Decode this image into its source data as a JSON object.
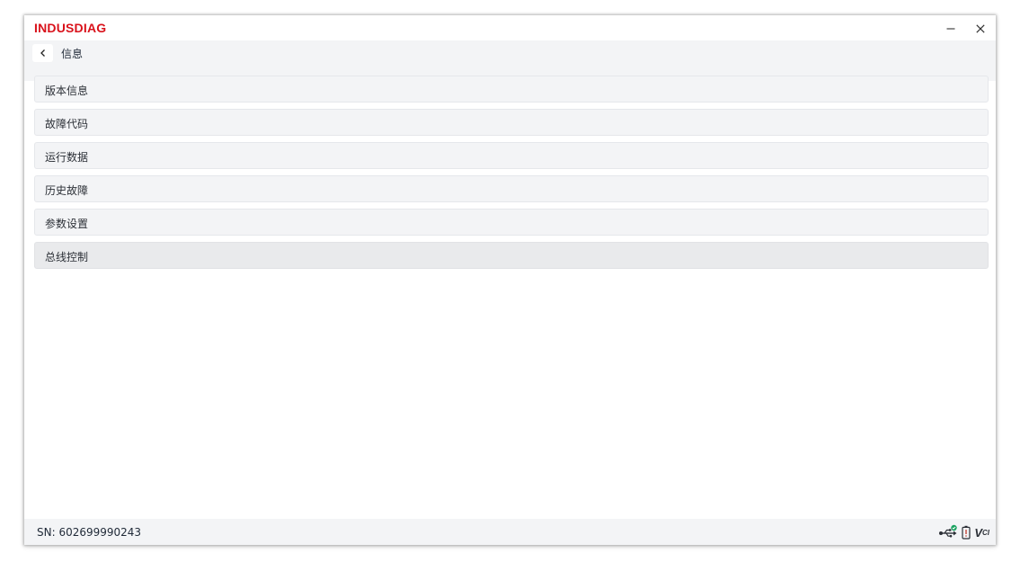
{
  "app": {
    "brand": "INDUSDIAG",
    "brand_color": "#d9121b"
  },
  "window_controls": {
    "minimize_icon": "minimize-icon",
    "close_icon": "close-icon"
  },
  "nav": {
    "back_icon": "chevron-left-icon",
    "title": "信息"
  },
  "menu": {
    "items": [
      {
        "label": "版本信息"
      },
      {
        "label": "故障代码"
      },
      {
        "label": "运行数据"
      },
      {
        "label": "历史故障"
      },
      {
        "label": "参数设置"
      },
      {
        "label": "总线控制",
        "active": true
      }
    ]
  },
  "footer": {
    "sn": "SN: 602699990243",
    "status_icons": [
      "usb-connected-icon",
      "battery-icon",
      "vci-icon"
    ],
    "vci_label": "V",
    "vci_sub": "CI",
    "connected_color": "#1aa260"
  }
}
